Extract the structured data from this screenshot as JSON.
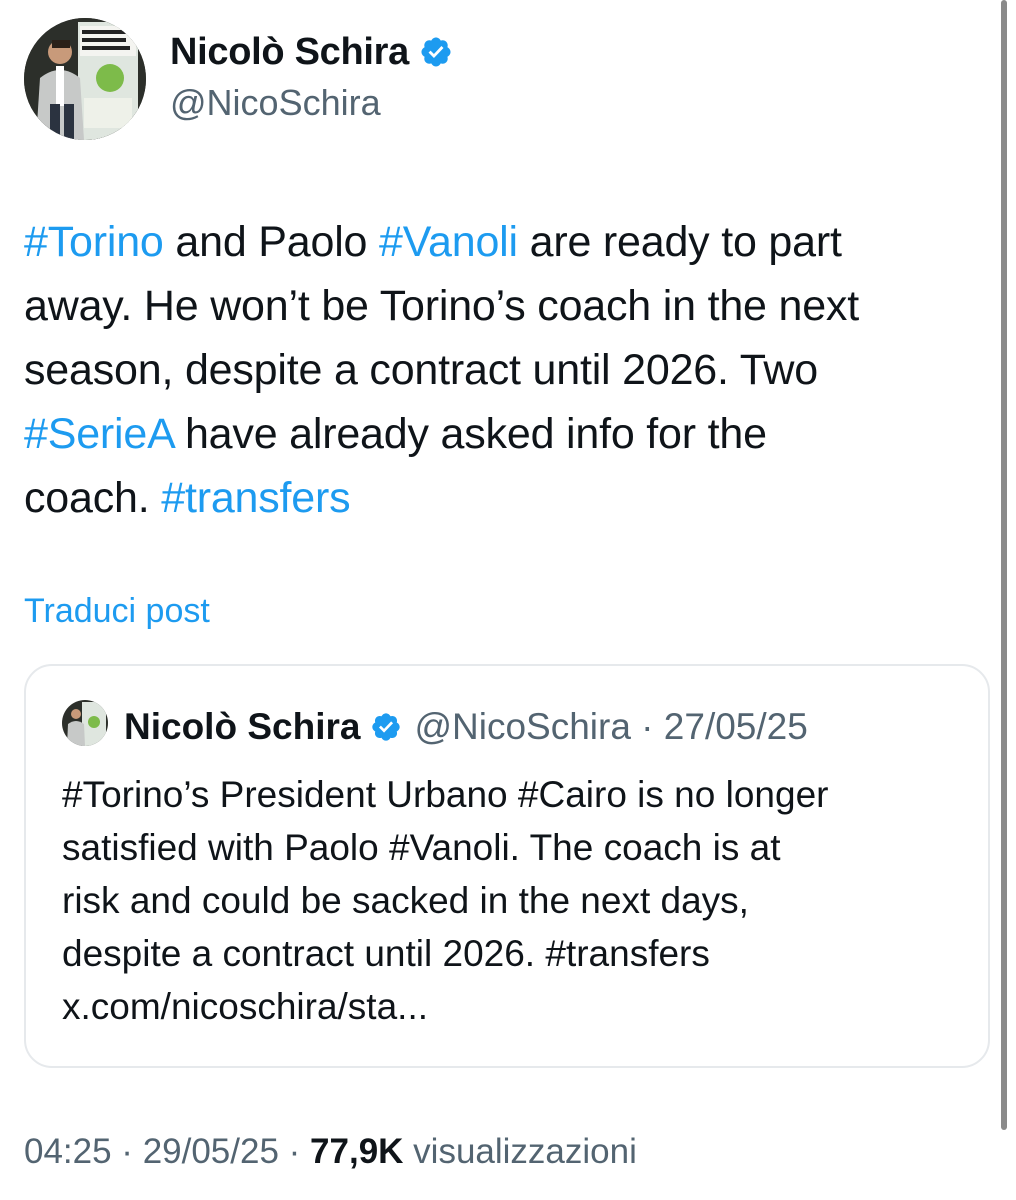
{
  "author": {
    "name": "Nicolò Schira",
    "handle": "@NicoSchira",
    "verified": true
  },
  "tweet": {
    "lines": [
      [
        {
          "t": "#Torino",
          "tag": true
        },
        {
          "t": " and Paolo ",
          "tag": false
        },
        {
          "t": "#Vanoli",
          "tag": true
        },
        {
          "t": " are ready to part",
          "tag": false
        }
      ],
      [
        {
          "t": "away. He won’t be Torino’s coach in the next",
          "tag": false
        }
      ],
      [
        {
          "t": "season, despite a contract until 2026. Two",
          "tag": false
        }
      ],
      [
        {
          "t": "#SerieA",
          "tag": true
        },
        {
          "t": " have already asked info for the",
          "tag": false
        }
      ],
      [
        {
          "t": "coach. ",
          "tag": false
        },
        {
          "t": "#transfers",
          "tag": true
        }
      ]
    ],
    "translate_label": "Traduci post"
  },
  "quoted": {
    "name": "Nicolò Schira",
    "handle_date": "@NicoSchira · 27/05/25",
    "lines": [
      "#Torino’s President Urbano #Cairo is no longer",
      "satisfied with Paolo #Vanoli. The coach is at",
      "risk and could be sacked in the next days,",
      "despite a contract until 2026. #transfers",
      "x.com/nicoschira/sta..."
    ]
  },
  "meta": {
    "time_date": "04:25 · 29/05/25 · ",
    "views_count": "77,9K",
    "views_label": " visualizzazioni"
  },
  "colors": {
    "accent": "#1d9bf0",
    "text": "#0f1419",
    "secondary": "#536471",
    "border": "#e6e9ec"
  },
  "icons": [
    "verified-badge-icon",
    "avatar-photo"
  ]
}
